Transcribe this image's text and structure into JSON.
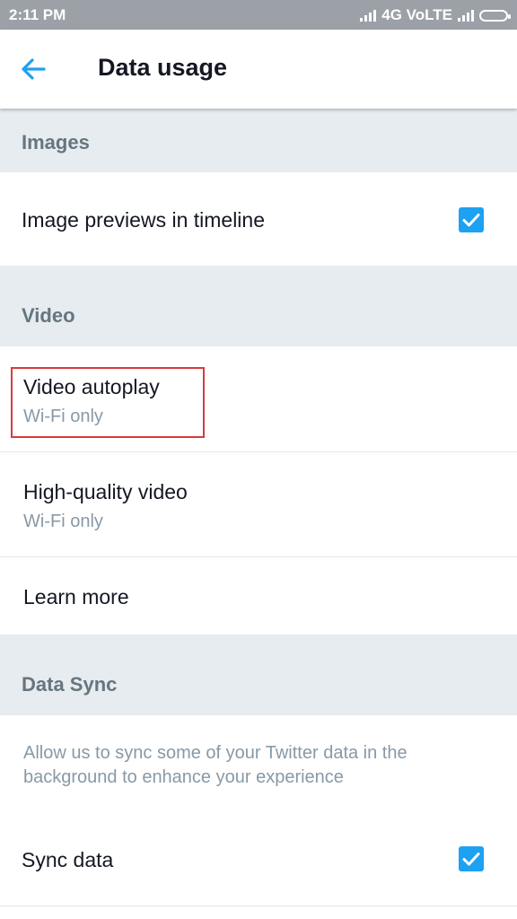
{
  "status_bar": {
    "time": "2:11 PM",
    "network": "4G VoLTE"
  },
  "header": {
    "title": "Data usage",
    "back_icon": "arrow-left-icon"
  },
  "sections": {
    "images": {
      "header": "Images",
      "image_previews": {
        "label": "Image previews in timeline",
        "checked": true
      }
    },
    "video": {
      "header": "Video",
      "autoplay": {
        "label": "Video autoplay",
        "value": "Wi-Fi only"
      },
      "high_quality": {
        "label": "High-quality video",
        "value": "Wi-Fi only"
      },
      "learn_more": {
        "label": "Learn more"
      }
    },
    "data_sync": {
      "header": "Data Sync",
      "description": "Allow us to sync some of your Twitter data in the background to enhance your experience",
      "sync": {
        "label": "Sync data",
        "checked": true
      }
    }
  },
  "colors": {
    "accent": "#1da1f2",
    "section_bg": "#e6ecf0",
    "highlight": "#d93a3a"
  }
}
